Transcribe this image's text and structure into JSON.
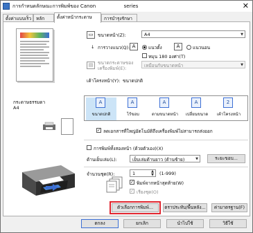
{
  "window": {
    "title": "การกำหนดลักษณะการพิมพ์ของ Canon",
    "title_suffix": "series"
  },
  "tabs": [
    {
      "label": "ตั้งค่าแบบเร็ว"
    },
    {
      "label": "หลัก"
    },
    {
      "label": "ตั้งค่าหน้ากระดาษ"
    },
    {
      "label": "การบำรุงรักษา"
    }
  ],
  "preview": {
    "paper_label": "กระดาษธรรมดา",
    "paper_size": "A4"
  },
  "page_size": {
    "label": "ขนาดหน้า(Z):",
    "value": "A4"
  },
  "orientation": {
    "label": "การวางแนว(Q):",
    "portrait": "แนวตั้ง",
    "landscape": "แนวนอน",
    "rotate_label": "หมุน 180 องศา(T)"
  },
  "printer_paper_size": {
    "label": "ขนาดกระดาษของเครื่องพิมพ์(E):",
    "value": "เหมือนกับขนาดหน้า"
  },
  "page_layout": {
    "label": "เค้าโครงหน้า(Y):",
    "current": "ขนาดปกติ",
    "items": [
      {
        "label": "ขนาดปกติ",
        "icon": "A"
      },
      {
        "label": "ไร้ขอบ",
        "icon": "A"
      },
      {
        "label": "ตามขนาดหน้า",
        "icon": "A"
      },
      {
        "label": "เปลี่ยนขนาด",
        "icon": "A"
      },
      {
        "label": "เค้าโครงหน้า",
        "icon": "2"
      }
    ]
  },
  "auto_reduce": {
    "label": "ลดเอกสารที่ใหญ่อัตโนมัติถึงเครื่องพิมพ์ไม่สามารถส่งออก"
  },
  "duplex": {
    "label": "การพิมพ์ทั้งสองหน้า (ด้วยตัวเอง)(X)",
    "stapling_label": "ด้านเย็บเล่ม(L):",
    "stapling_value": "เย็บเล่มด้านยาว (ด้านซ้าย)",
    "margin_button": "ระยะขอบ..."
  },
  "copies": {
    "label": "จำนวนชุด(R):",
    "value": "1",
    "range": "(1-999)",
    "last_page_first": "พิมพ์จากหน้าสุดท้าย(W)",
    "collate": "เรียงชุด(O)"
  },
  "action_buttons": {
    "print_options": "ตัวเลือกการพิมพ์...",
    "stamp_background": "ตราประทับ/พื้นหลัง...",
    "defaults": "ค่ามาตรฐาน(F)"
  },
  "dialog_buttons": {
    "ok": "ตกลง",
    "cancel": "ยกเลิก",
    "apply": "นำไปใช้",
    "help": "วิธีใช้"
  },
  "colors": {
    "highlight": "#e0252e",
    "accent": "#3c6fd4"
  }
}
